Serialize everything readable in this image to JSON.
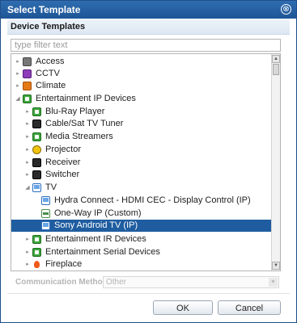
{
  "window": {
    "title": "Select Template",
    "close_glyph": "⊗"
  },
  "section": {
    "title": "Device Templates"
  },
  "filter": {
    "placeholder": "type filter text",
    "value": ""
  },
  "tree": {
    "rows": [
      {
        "label": "Access",
        "expander": "▸",
        "icon": "access-icon"
      },
      {
        "label": "CCTV",
        "expander": "▸",
        "icon": "camera-icon"
      },
      {
        "label": "Climate",
        "expander": "▸",
        "icon": "thermostat-icon"
      },
      {
        "label": "Entertainment IP Devices",
        "expander": "◢",
        "icon": "ip-device-icon"
      },
      {
        "label": "Blu-Ray Player",
        "expander": "▸",
        "icon": "ip-device-icon"
      },
      {
        "label": "Cable/Sat TV Tuner",
        "expander": "▸",
        "icon": "tuner-icon"
      },
      {
        "label": "Media Streamers",
        "expander": "▸",
        "icon": "ip-device-icon"
      },
      {
        "label": "Projector",
        "expander": "▸",
        "icon": "projector-icon"
      },
      {
        "label": "Receiver",
        "expander": "▸",
        "icon": "receiver-icon"
      },
      {
        "label": "Switcher",
        "expander": "▸",
        "icon": "switcher-icon"
      },
      {
        "label": "TV",
        "expander": "◢",
        "icon": "tv-icon"
      },
      {
        "label": "Hydra Connect - HDMI CEC - Display Control (IP)",
        "expander": "",
        "icon": "tv-icon"
      },
      {
        "label": "One-Way IP (Custom)",
        "expander": "",
        "icon": "one-way-icon"
      },
      {
        "label": "Sony Android TV (IP)",
        "expander": "",
        "icon": "tv-icon",
        "selected": true
      },
      {
        "label": "Entertainment IR Devices",
        "expander": "▸",
        "icon": "ip-device-icon"
      },
      {
        "label": "Entertainment Serial Devices",
        "expander": "▸",
        "icon": "ip-device-icon"
      },
      {
        "label": "Fireplace",
        "expander": "▸",
        "icon": "fireplace-icon"
      }
    ]
  },
  "communication": {
    "label": "Communication Method:",
    "value": "Other"
  },
  "buttons": {
    "ok": "OK",
    "cancel": "Cancel"
  }
}
